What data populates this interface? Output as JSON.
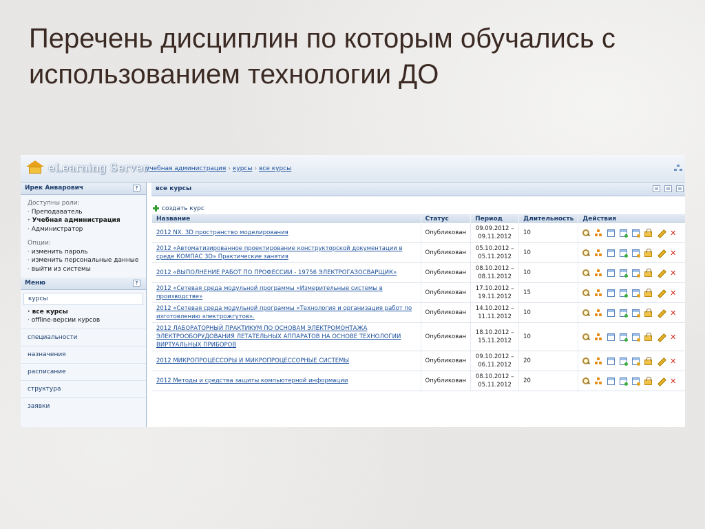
{
  "slide": {
    "title": "Перечень дисциплин по которым обучались с использованием технологии ДО"
  },
  "app": {
    "logo_text": "eLearning Server",
    "breadcrumb": [
      "учебная администрация",
      "курсы",
      "все курсы"
    ],
    "breadcrumb_sep": "›"
  },
  "sidebar": {
    "user_name": "Ирек Анварович",
    "help": "?",
    "roles_label": "Доступны роли:",
    "roles": [
      "Преподаватель",
      "Учебная администрация",
      "Администратор"
    ],
    "options_label": "Опции:",
    "options": [
      "изменить пароль",
      "изменить персональные данные",
      "выйти из системы"
    ],
    "menu_title": "Меню",
    "menu_active": "курсы",
    "menu_sub": [
      "все курсы",
      "offline-версии курсов"
    ],
    "menu_items": [
      "специальности",
      "назначения",
      "расписание",
      "структура",
      "заявки"
    ]
  },
  "main": {
    "title": "все курсы",
    "create_label": "создать курс",
    "columns": [
      "Название",
      "Статус",
      "Период",
      "Длительность",
      "Действия"
    ],
    "rows": [
      {
        "name": "2012 NX. 3D пространство моделирования",
        "status": "Опубликован",
        "start": "09.09.2012 –",
        "end": "09.11.2012",
        "duration": "10"
      },
      {
        "name": "2012 «Автоматизированное проектирование конструкторской документации в среде КОМПАС 3D» Практические занятия",
        "status": "Опубликован",
        "start": "05.10.2012 –",
        "end": "05.11.2012",
        "duration": "10"
      },
      {
        "name": "2012 «ВЫПОЛНЕНИЕ РАБОТ ПО ПРОФЕССИИ - 19756 ЭЛЕКТРОГАЗОСВАРЩИК»",
        "status": "Опубликован",
        "start": "08.10.2012 –",
        "end": "08.11.2012",
        "duration": "10"
      },
      {
        "name": "2012 «Сетевая среда модульной программы «Измерительные системы в производстве»",
        "status": "Опубликован",
        "start": "17.10.2012 –",
        "end": "19.11.2012",
        "duration": "15"
      },
      {
        "name": "2012 «Сетевая среда модульной программы «Технология и организация работ по изготовлению электрожгутов».",
        "status": "Опубликован",
        "start": "14.10.2012 –",
        "end": "11.11.2012",
        "duration": "10"
      },
      {
        "name": "2012 ЛАБОРАТОРНЫЙ ПРАКТИКУМ ПО ОСНОВАМ ЭЛЕКТРОМОНТАЖА ЭЛЕКТРООБОРУДОВАНИЯ ЛЕТАТЕЛЬНЫХ АППАРАТОВ НА ОСНОВЕ ТЕХНОЛОГИИ ВИРТУАЛЬНЫХ ПРИБОРОВ",
        "status": "Опубликован",
        "start": "18.10.2012 –",
        "end": "15.11.2012",
        "duration": "10"
      },
      {
        "name": "2012 МИКРОПРОЦЕССОРЫ И МИКРОПРОЦЕССОРНЫЕ СИСТЕМЫ",
        "status": "Опубликован",
        "start": "09.10.2012 –",
        "end": "06.11.2012",
        "duration": "20"
      },
      {
        "name": "2012 Методы и средства защиты компьютерной информации",
        "status": "Опубликован",
        "start": "08.10.2012 –",
        "end": "05.11.2012",
        "duration": "20"
      }
    ],
    "action_icons": [
      "search-icon",
      "people-icon",
      "window-icon",
      "window-add-icon",
      "window-edit-icon",
      "lock-icon",
      "pencil-icon",
      "delete-icon"
    ],
    "delete_glyph": "✕"
  }
}
